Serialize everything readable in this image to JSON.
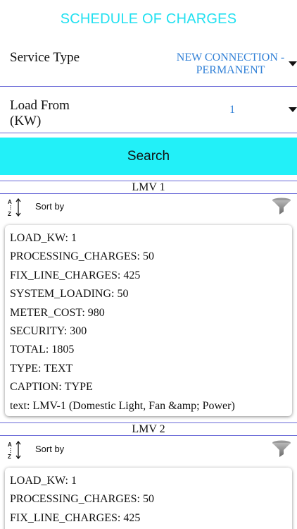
{
  "header": {
    "title": "SCHEDULE OF CHARGES"
  },
  "form": {
    "service_type": {
      "label": "Service Type",
      "value_line1": "NEW CONNECTION -",
      "value_line2": "PERMANENT",
      "icon": "caret-down-icon"
    },
    "load_from": {
      "label_line1": "Load From",
      "label_line2": "(KW)",
      "value": "1",
      "icon": "caret-down-icon"
    },
    "search_label": "Search"
  },
  "colors": {
    "title": "#22e0f0",
    "search_button": "#22f0f8",
    "dropdown_value": "#2f7fd6",
    "divider": "#6a6ad8"
  },
  "sections": [
    {
      "header": "LMV 1",
      "sort_label": "Sort by",
      "sort_icon": "sort-az-icon",
      "filter_icon": "filter-icon",
      "fields": [
        {
          "key": "LOAD_KW:",
          "value": "1"
        },
        {
          "key": "PROCESSING_CHARGES:",
          "value": "50"
        },
        {
          "key": "FIX_LINE_CHARGES:",
          "value": "425"
        },
        {
          "key": "SYSTEM_LOADING:",
          "value": "50"
        },
        {
          "key": "METER_COST:",
          "value": "980"
        },
        {
          "key": "SECURITY:",
          "value": "300"
        },
        {
          "key": "TOTAL:",
          "value": "1805"
        },
        {
          "key": "TYPE:",
          "value": "TEXT"
        },
        {
          "key": "CAPTION:",
          "value": "TYPE"
        },
        {
          "key": "text:",
          "value": "LMV-1 (Domestic Light, Fan &amp; Power)"
        }
      ]
    },
    {
      "header": "LMV 2",
      "sort_label": "Sort by",
      "sort_icon": "sort-az-icon",
      "filter_icon": "filter-icon",
      "fields": [
        {
          "key": "LOAD_KW:",
          "value": "1"
        },
        {
          "key": "PROCESSING_CHARGES:",
          "value": "50"
        },
        {
          "key": "FIX_LINE_CHARGES:",
          "value": "425"
        }
      ]
    }
  ]
}
